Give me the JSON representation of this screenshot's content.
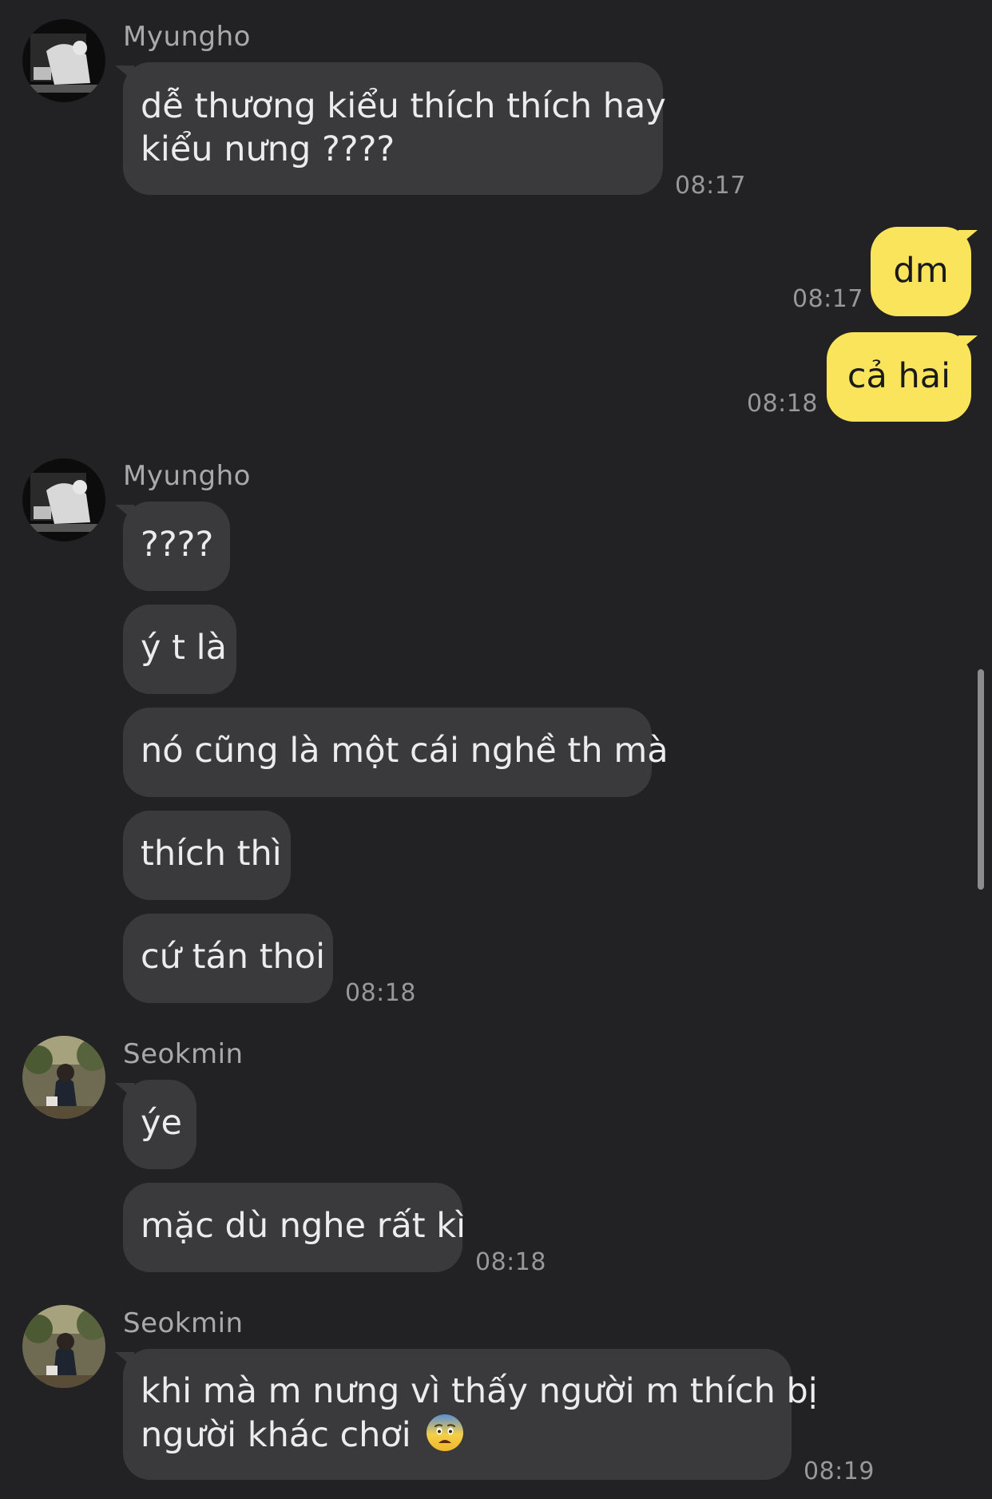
{
  "chat": {
    "group1": {
      "sender": "Myungho",
      "messages": [
        "dễ thương kiểu thích thích hay kiểu nưng ????"
      ],
      "msg1_line1": "dễ thương kiểu thích thích hay",
      "msg1_line2": "kiểu nưng ????",
      "time": "08:17"
    },
    "outgoing": {
      "msg1": "dm",
      "time1": "08:17",
      "msg2": "cả hai",
      "time2": "08:18"
    },
    "group2": {
      "sender": "Myungho",
      "messages": [
        "????",
        "ý t là",
        "nó cũng là một cái nghề th mà",
        "thích thì",
        "cứ tán thoi"
      ],
      "time": "08:18"
    },
    "group3": {
      "sender": "Seokmin",
      "messages": [
        "ýe",
        "mặc dù nghe rất kì"
      ],
      "time": "08:18"
    },
    "group4": {
      "sender": "Seokmin",
      "messages": [
        "khi mà m nưng vì thấy người m thích bị người khác chơi 😨"
      ],
      "msg1_line1": "khi mà m nưng vì thấy người m thích bị",
      "msg1_line2": "người khác chơi",
      "emoji": "fearful-face-emoji",
      "time": "08:19"
    }
  },
  "colors": {
    "background": "#222224",
    "incoming_bubble": "#3a3a3d",
    "outgoing_bubble": "#f9e45b",
    "timestamp": "#97979c",
    "sender_name": "#a9a9ad"
  }
}
